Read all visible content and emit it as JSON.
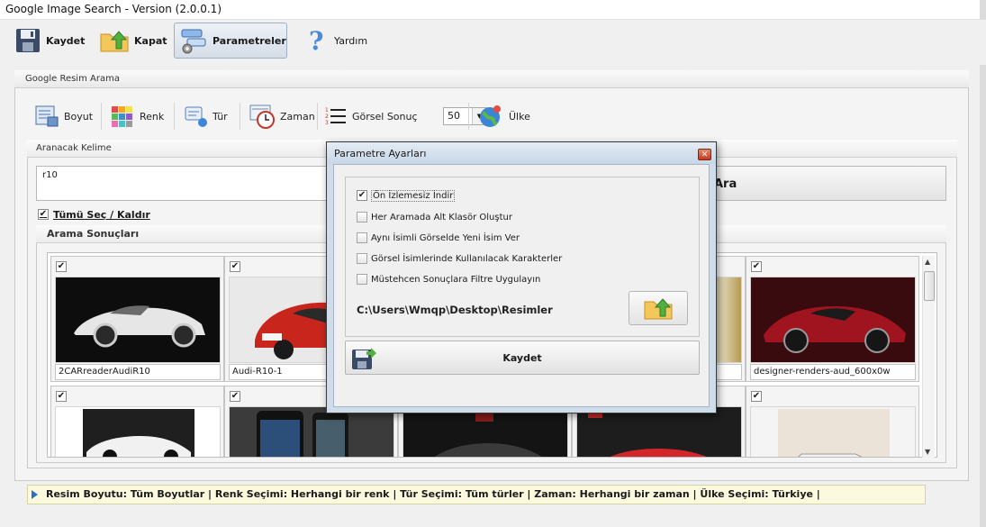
{
  "window": {
    "title": "Google Image Search - Version (2.0.0.1)"
  },
  "toolbar": {
    "save": "Kaydet",
    "close": "Kapat",
    "params": "Parametreler",
    "help": "Yardım"
  },
  "search_group": {
    "title": "Google Resim Arama",
    "filters": {
      "size": "Boyut",
      "color": "Renk",
      "type": "Tür",
      "time": "Zaman",
      "result_count_label": "Görsel Sonuç",
      "result_count_value": "50",
      "country": "Ülke"
    },
    "keyword_label": "Aranacak Kelime",
    "keyword_value": "r10",
    "search_button": "Ara",
    "select_all": "Tümü Seç / Kaldır",
    "results_title": "Arama Sonuçları",
    "results": [
      {
        "caption": "2CARreaderAudiR10",
        "checked": true
      },
      {
        "caption": "Audi-R10-1",
        "checked": true
      },
      {
        "caption": "",
        "checked": true
      },
      {
        "caption": "",
        "checked": true
      },
      {
        "caption": "designer-renders-aud_600x0w",
        "checked": true
      },
      {
        "caption": "",
        "checked": true
      },
      {
        "caption": "",
        "checked": true
      },
      {
        "caption": "",
        "checked": true
      },
      {
        "caption": "",
        "checked": true
      },
      {
        "caption": "",
        "checked": true
      }
    ]
  },
  "status": {
    "text": "Resim Boyutu: Tüm Boyutlar  | Renk Seçimi: Herhangi bir renk  | Tür Seçimi: Tüm türler  | Zaman: Herhangi bir zaman  | Ülke Seçimi: Türkiye  |"
  },
  "dialog": {
    "title": "Parametre Ayarları",
    "options": [
      {
        "label": "Ön İzlemesiz İndir",
        "checked": true
      },
      {
        "label": "Her Aramada Alt Klasör Oluştur",
        "checked": false
      },
      {
        "label": "Aynı İsimli Görselde Yeni İsim Ver",
        "checked": false
      },
      {
        "label": "Görsel İsimlerinde Kullanılacak Karakterler",
        "checked": false
      },
      {
        "label": "Müstehcen Sonuçlara Filtre Uygulayın",
        "checked": false
      }
    ],
    "path": "C:\\Users\\Wmqp\\Desktop\\Resimler",
    "save_button": "Kaydet"
  },
  "colors": {
    "accent": "#2b6fc7",
    "status_bg": "#fbfadf",
    "dialog_frame": "#cfdcea"
  },
  "icons": [
    "save-icon",
    "folder-up-icon",
    "settings-icon",
    "help-icon",
    "size-icon",
    "color-grid-icon",
    "type-icon",
    "clock-icon",
    "numbered-list-icon",
    "globe-icon"
  ]
}
